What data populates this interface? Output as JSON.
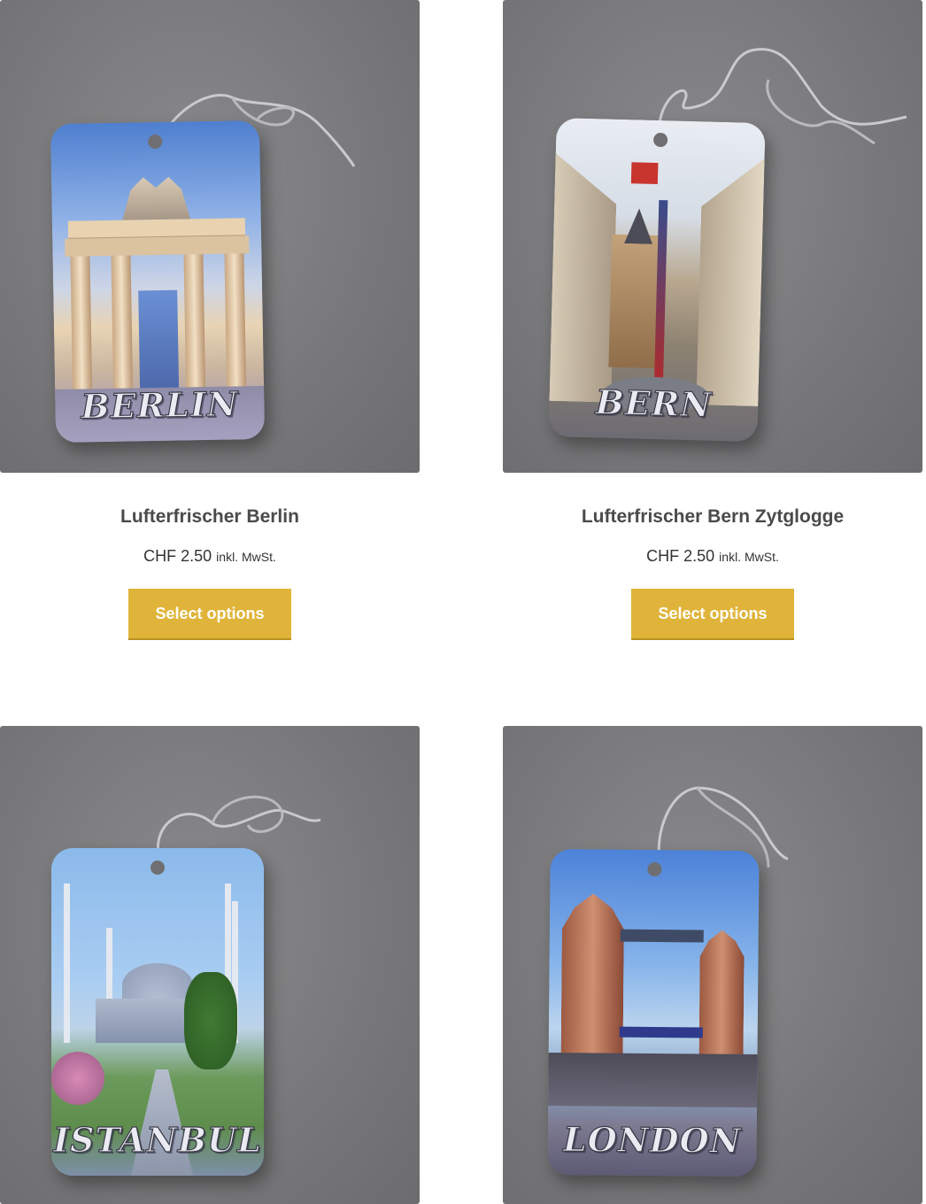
{
  "products": [
    {
      "title": "Lufterfrischer Berlin",
      "price": "CHF 2.50",
      "tax_note": "inkl. MwSt.",
      "button_label": "Select options",
      "tag_city": "BERLIN"
    },
    {
      "title": "Lufterfrischer Bern Zytglogge",
      "price": "CHF 2.50",
      "tax_note": "inkl. MwSt.",
      "button_label": "Select options",
      "tag_city": "BERN"
    },
    {
      "title": "",
      "price": "",
      "tax_note": "",
      "button_label": "",
      "tag_city": "ISTANBUL"
    },
    {
      "title": "",
      "price": "",
      "tax_note": "",
      "button_label": "",
      "tag_city": "LONDON"
    }
  ],
  "colors": {
    "button_bg": "#e0b43a",
    "photo_bg": "#79797b",
    "title_text": "#4a4a4c"
  }
}
